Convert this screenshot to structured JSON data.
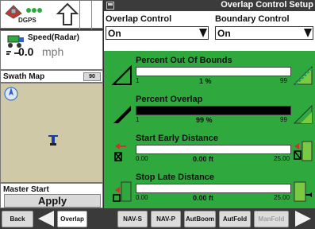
{
  "left": {
    "gps_label": "DGPS",
    "speed_title": "Speed(Radar)",
    "speed_value": "0.0",
    "speed_unit": "mph",
    "swath_title": "Swath Map",
    "swath_zoom": "90",
    "master_title": "Master Start",
    "apply_label": "Apply"
  },
  "panel": {
    "title": "Overlap Control Setup",
    "overlap_control_label": "Overlap Control",
    "overlap_control_value": "On",
    "boundary_control_label": "Boundary Control",
    "boundary_control_value": "On"
  },
  "rows": [
    {
      "title": "Percent Out Of Bounds",
      "min": "1",
      "value": "1 %",
      "max": "99",
      "fill": 0.0
    },
    {
      "title": "Percent Overlap",
      "min": "1",
      "value": "99 %",
      "max": "99",
      "fill": 1.0
    },
    {
      "title": "Start Early Distance",
      "min": "0.00",
      "value": "0.00 ft",
      "max": "25.00",
      "fill": 0.0
    },
    {
      "title": "Stop Late Distance",
      "min": "0.00",
      "value": "0.00 ft",
      "max": "25.00",
      "fill": 0.0
    }
  ],
  "nav": {
    "back": "Back",
    "overlap": "Overlap",
    "nav_s": "NAV-S",
    "nav_p": "NAV-P",
    "autboom": "AutBoom",
    "autfold": "AutFold",
    "manfold": "ManFold"
  },
  "colors": {
    "panel_green": "#2fa93e",
    "dark_bg": "#3a3a3a",
    "disabled_text": "#a0a0a0"
  }
}
